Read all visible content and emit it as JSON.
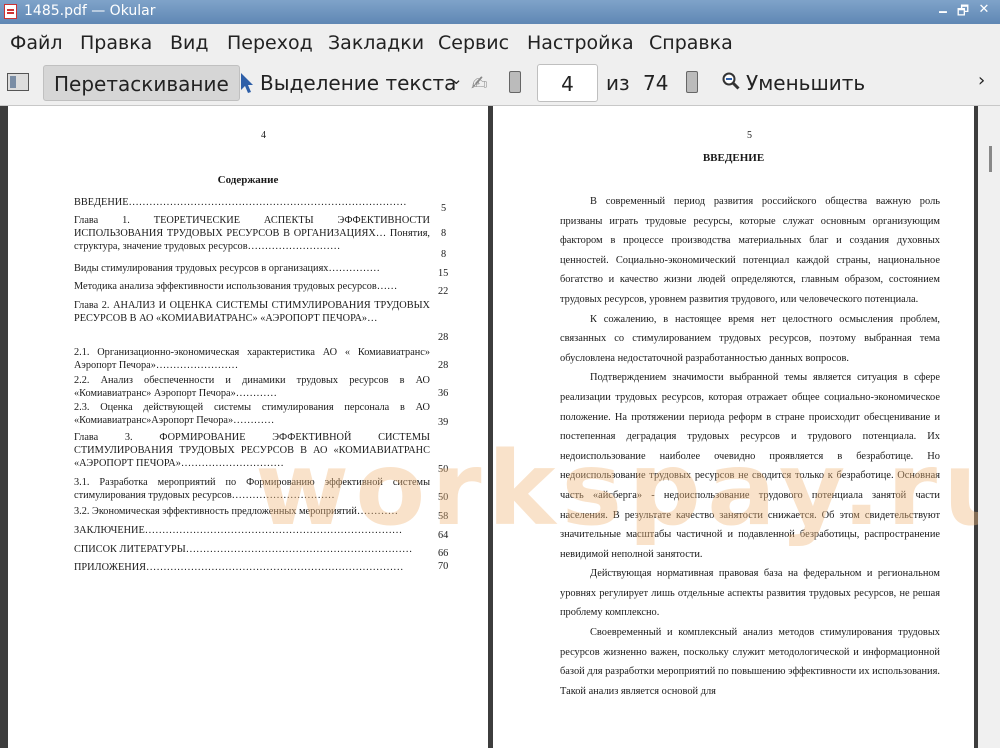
{
  "window": {
    "title": "1485.pdf  — Okular",
    "minimize": "🗕",
    "restore": "🗗"
  },
  "menu": [
    "Файл",
    "Правка",
    "Вид",
    "Переход",
    "Закладки",
    "Сервис",
    "Настройка",
    "Справка"
  ],
  "toolbar": {
    "browse_label": "Перетаскивание",
    "select_label": "Выделение текста",
    "page_value": "4",
    "of_label": "из",
    "total_pages": "74",
    "zoom_out_label": "Уменьшить"
  },
  "left_page": {
    "number": "4",
    "title": "Содержание",
    "toc": [
      {
        "text": "ВВЕДЕНИЕ………………………………………………………………………",
        "page": "5"
      },
      {
        "text": "Глава 1. ТЕОРЕТИЧЕСКИЕ АСПЕКТЫ ЭФФЕКТИВНОСТИ ИСПОЛЬЗОВАНИЯ ТРУДОВЫХ РЕСУРСОВ В ОРГАНИЗАЦИЯХ… Понятия, структура, значение трудовых ресурсов………………………",
        "page": "8"
      },
      {
        "text": "",
        "page": "8"
      },
      {
        "text": "Виды стимулирования трудовых ресурсов в организациях……………",
        "page": "15"
      },
      {
        "text": "Методика анализа эффективности использования трудовых ресурсов……",
        "page": "22"
      },
      {
        "text": "Глава 2. АНАЛИЗ И ОЦЕНКА СИСТЕМЫ СТИМУЛИРОВАНИЯ ТРУДОВЫХ РЕСУРСОВ В АО «КОМИАВИАТРАНС» «АЭРОПОРТ ПЕЧОРА»…",
        "page": "28"
      },
      {
        "text": "2.1. Организационно-экономическая характеристика АО « Комиавиатранс» Аэропорт Печора»……………………",
        "page": "28"
      },
      {
        "text": "2.2. Анализ обеспеченности и динамики трудовых ресурсов в АО «Комиавиатранс» Аэропорт Печора»…………",
        "page": "36"
      },
      {
        "text": "2.3. Оценка действующей системы стимулирования персонала в АО «Комиавиатранс»Аэропорт Печора»…………",
        "page": "39"
      },
      {
        "text": "Глава 3. ФОРМИРОВАНИЕ ЭФФЕКТИВНОЙ СИСТЕМЫ СТИМУЛИРОВАНИЯ ТРУДОВЫХ РЕСУРСОВ В АО «КОМИАВИАТРАНС «АЭРОПОРТ ПЕЧОРА»…………………………",
        "page": "50"
      },
      {
        "text": "3.1. Разработка мероприятий по Формированию эффективной системы стимулирования трудовых ресурсов…………………………",
        "page": "50"
      },
      {
        "text": "3.2. Экономическая эффективность предложенных мероприятий…………",
        "page": "58"
      },
      {
        "text": "ЗАКЛЮЧЕНИЕ…………………………………………………………………",
        "page": "64"
      },
      {
        "text": "СПИСОК ЛИТЕРАТУРЫ…………………………………………………………",
        "page": "66"
      },
      {
        "text": "ПРИЛОЖЕНИЯ…………………………………………………………………",
        "page": "70"
      }
    ]
  },
  "right_page": {
    "number": "5",
    "title": "ВВЕДЕНИЕ",
    "paragraphs": [
      "В современный период развития российского общества важную роль призваны играть трудовые ресурсы, которые служат основным организующим фактором в процессе производства материальных благ и создания духовных ценностей. Социально-экономический потенциал каждой страны, национальное богатство и качество жизни людей определяются, главным образом, состоянием трудовых ресурсов, уровнем развития трудового, или человеческого потенциала.",
      "К сожалению, в настоящее время нет целостного осмысления проблем, связанных со стимулированием трудовых ресурсов, поэтому выбранная тема обусловлена недостаточной разработанностью данных вопросов.",
      "Подтверждением значимости выбранной темы является ситуация в сфере реализации трудовых ресурсов, которая отражает общее социально-экономическое положение. На протяжении периода реформ в стране происходит обесценивание и постепенная деградация трудовых ресурсов и трудового потенциала. Их недоиспользование наиболее очевидно проявляется в безработице. Но недоиспользование трудовых ресурсов не сводится только к безработице. Основная часть «айсберга» - недоиспользование трудового потенциала занятой части населения. В результате качество занятости снижается. Об этом свидетельствуют значительные масштабы частичной и подавленной безработицы, распространение невидимой неполной занятости.",
      "Действующая нормативная правовая база на федеральном и региональном уровнях регулирует лишь отдельные аспекты развития трудовых ресурсов, не решая проблему комплексно.",
      "Своевременный и комплексный анализ методов стимулирования трудовых ресурсов жизненно важен, поскольку служит методологической и информационной базой для разработки мероприятий по повышению эффективности их использования. Такой анализ является основой для"
    ]
  },
  "watermark": "workspay.ru",
  "colors": {
    "titlebar": "#6a91bd",
    "watermark": "#f1b97d"
  }
}
